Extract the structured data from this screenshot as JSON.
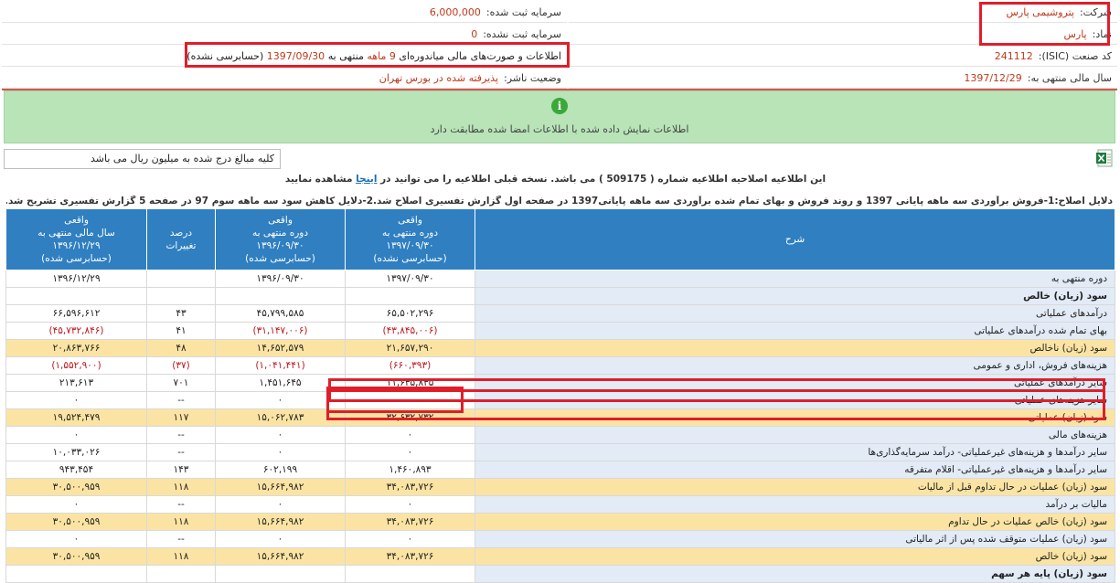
{
  "header": {
    "company_label": "شرکت:",
    "company_value": "پتروشیمی پارس",
    "symbol_label": "نماد:",
    "symbol_value": "پارس",
    "isic_label": "کد صنعت (ISIC):",
    "isic_value": "241112",
    "fiscal_label": "سال مالی منتهی به:",
    "fiscal_value": "1397/12/29",
    "reg_capital_label": "سرمایه ثبت شده:",
    "reg_capital_value": "6,000,000",
    "unreg_capital_label": "سرمایه ثبت نشده:",
    "unreg_capital_value": "0",
    "report_prefix": "اطلاعات و صورت‌های مالی میاندوره‌ای",
    "report_months": "9 ماهه",
    "report_mid": "منتهی به",
    "report_date": "1397/09/30",
    "report_suffix": "(حسابرسی نشده)",
    "publisher_label": "وضعیت ناشر:",
    "publisher_value": "پذیرفته شده در بورس تهران"
  },
  "banner": {
    "icon": "i",
    "text": "اطلاعات نمایش داده شده با اطلاعات امضا شده مطابقت دارد"
  },
  "unit_note": "کلیه مبالغ درج شده به میلیون ریال می باشد",
  "notice": {
    "before": "این اطلاعیه اصلاحیه اطلاعیه شماره ( 509175 ) می باشد. نسخه قبلی اطلاعیه را می توانید در",
    "link": "اینجا",
    "after": "مشاهده نمایید",
    "reason": "دلایل اصلاح:1-فروش برآوردی سه ماهه پایانی 1397 و روند فروش و بهای تمام شده برآوردی سه ماهه پایانی1397 در صفحه اول گزارش تفسیری اصلاح شد.2-دلایل کاهش سود سه ماهه سوم 97 در صفحه 5 گزارش تفسیری تشریح شد."
  },
  "table": {
    "headers": {
      "desc": "شرح",
      "col1": "واقعی\nدوره منتهی به\n۱۳۹۷/۰۹/۳۰\n(حسابرسی نشده)",
      "col2": "واقعی\nدوره منتهی به\n۱۳۹۶/۰۹/۳۰\n(حسابرسی شده)",
      "col3": "درصد\nتغییرات",
      "col4": "واقعی\nسال مالی منتهی به\n۱۳۹۶/۱۲/۲۹\n(حسابرسی شده)"
    },
    "rows": [
      {
        "desc": "دوره منتهی به",
        "c1": "۱۳۹۷/۰۹/۳۰",
        "c2": "۱۳۹۶/۰۹/۳۰",
        "c3": "",
        "c4": "۱۳۹۶/۱۲/۲۹"
      },
      {
        "desc": "سود (زیان) خالص",
        "c1": "",
        "c2": "",
        "c3": "",
        "c4": "",
        "bold": true
      },
      {
        "desc": "درآمدهای عملیاتی",
        "c1": "۶۵,۵۰۲,۲۹۶",
        "c2": "۴۵,۷۹۹,۵۸۵",
        "c3": "۴۳",
        "c4": "۶۶,۵۹۶,۶۱۲"
      },
      {
        "desc": "بهای تمام شده درآمدهای عملیاتی",
        "c1": "(۴۳,۸۴۵,۰۰۶)",
        "c2": "(۳۱,۱۴۷,۰۰۶)",
        "c3": "۴۱",
        "c4": "(۴۵,۷۳۲,۸۴۶)",
        "neg": true
      },
      {
        "desc": "سود (زیان) ناخالص",
        "c1": "۲۱,۶۵۷,۲۹۰",
        "c2": "۱۴,۶۵۲,۵۷۹",
        "c3": "۴۸",
        "c4": "۲۰,۸۶۳,۷۶۶",
        "hl": true
      },
      {
        "desc": "هزینه‌های فروش، اداری و عمومی",
        "c1": "(۶۶۰,۳۹۳)",
        "c2": "(۱,۰۴۱,۴۴۱)",
        "c3": "(۳۷)",
        "c4": "(۱,۵۵۲,۹۰۰)",
        "neg": true
      },
      {
        "desc": "سایر درآمدهای عملیاتی",
        "c1": "۱۱,۶۳۵,۸۳۵",
        "c2": "۱,۴۵۱,۶۴۵",
        "c3": "۷۰۱",
        "c4": "۲۱۳,۶۱۳"
      },
      {
        "desc": "سایر هزینه‌های عملیاتی",
        "c1": "۰",
        "c2": "۰",
        "c3": "--",
        "c4": "۰"
      },
      {
        "desc": "سود (زیان) عملیاتی",
        "c1": "۳۲,۶۳۲,۷۳۲",
        "c2": "۱۵,۰۶۲,۷۸۳",
        "c3": "۱۱۷",
        "c4": "۱۹,۵۲۴,۴۷۹",
        "hl": true
      },
      {
        "desc": "هزینه‌های مالی",
        "c1": "۰",
        "c2": "۰",
        "c3": "--",
        "c4": "۰"
      },
      {
        "desc": "سایر درآمدها و هزینه‌های غیرعملیاتی- درآمد سرمایه‌گذاری‌ها",
        "c1": "۰",
        "c2": "۰",
        "c3": "--",
        "c4": "۱۰,۰۳۳,۰۲۶"
      },
      {
        "desc": "سایر درآمدها و هزینه‌های غیرعملیاتی- اقلام متفرقه",
        "c1": "۱,۴۶۰,۸۹۳",
        "c2": "۶۰۲,۱۹۹",
        "c3": "۱۴۳",
        "c4": "۹۴۳,۴۵۴"
      },
      {
        "desc": "سود (زیان) عملیات در حال تداوم قبل از مالیات",
        "c1": "۳۴,۰۸۳,۷۲۶",
        "c2": "۱۵,۶۶۴,۹۸۲",
        "c3": "۱۱۸",
        "c4": "۳۰,۵۰۰,۹۵۹",
        "hl": true
      },
      {
        "desc": "مالیات بر درآمد",
        "c1": "۰",
        "c2": "۰",
        "c3": "--",
        "c4": "۰"
      },
      {
        "desc": "سود (زیان) خالص عملیات در حال تداوم",
        "c1": "۳۴,۰۸۳,۷۲۶",
        "c2": "۱۵,۶۶۴,۹۸۲",
        "c3": "۱۱۸",
        "c4": "۳۰,۵۰۰,۹۵۹",
        "hl": true
      },
      {
        "desc": "سود (زیان) عملیات متوقف شده پس از اثر مالیاتی",
        "c1": "۰",
        "c2": "۰",
        "c3": "--",
        "c4": "۰"
      },
      {
        "desc": "سود (زیان) خالص",
        "c1": "۳۴,۰۸۳,۷۲۶",
        "c2": "۱۵,۶۶۴,۹۸۲",
        "c3": "۱۱۸",
        "c4": "۳۰,۵۰۰,۹۵۹",
        "hl": true
      },
      {
        "desc": "سود (زیان) پایه هر سهم",
        "c1": "",
        "c2": "",
        "c3": "",
        "c4": "",
        "bold": true
      }
    ]
  },
  "colors": {
    "accent_red": "#c0391b",
    "header_blue": "#2f7fc1",
    "highlight_yellow": "#fbe4a3",
    "banner_green": "#b8e4b8"
  }
}
